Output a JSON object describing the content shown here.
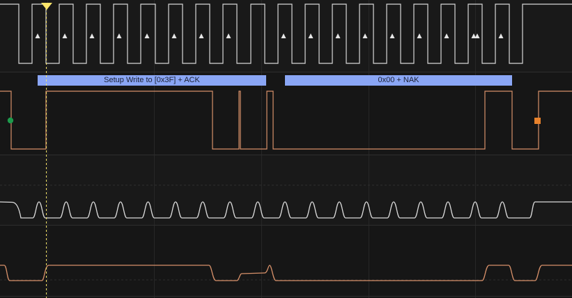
{
  "decoder": {
    "setup_label": "Setup Write to [0x3F] + ACK",
    "data_label": "0x00 + NAK"
  },
  "markers": {
    "start_marker_label": "start",
    "stop_marker_label": "stop"
  },
  "colors": {
    "background": "#141414",
    "channel_alt": "#1a1a1a",
    "divider": "#2a2a2a",
    "grid": "#2c2c2c",
    "digital_scl": "#d8d8d8",
    "digital_sda": "#d8916a",
    "analog_scl": "#dcdcdc",
    "analog_sda": "#d8916a",
    "decode_fill": "#8aa6f5",
    "cursor": "#ffe66b",
    "start_marker": "#1d9a4c",
    "stop_marker": "#e8822c"
  },
  "channels": [
    {
      "name": "scl-digital-channel"
    },
    {
      "name": "sda-digital-channel"
    },
    {
      "name": "scl-analog-channel"
    },
    {
      "name": "sda-analog-channel"
    }
  ]
}
